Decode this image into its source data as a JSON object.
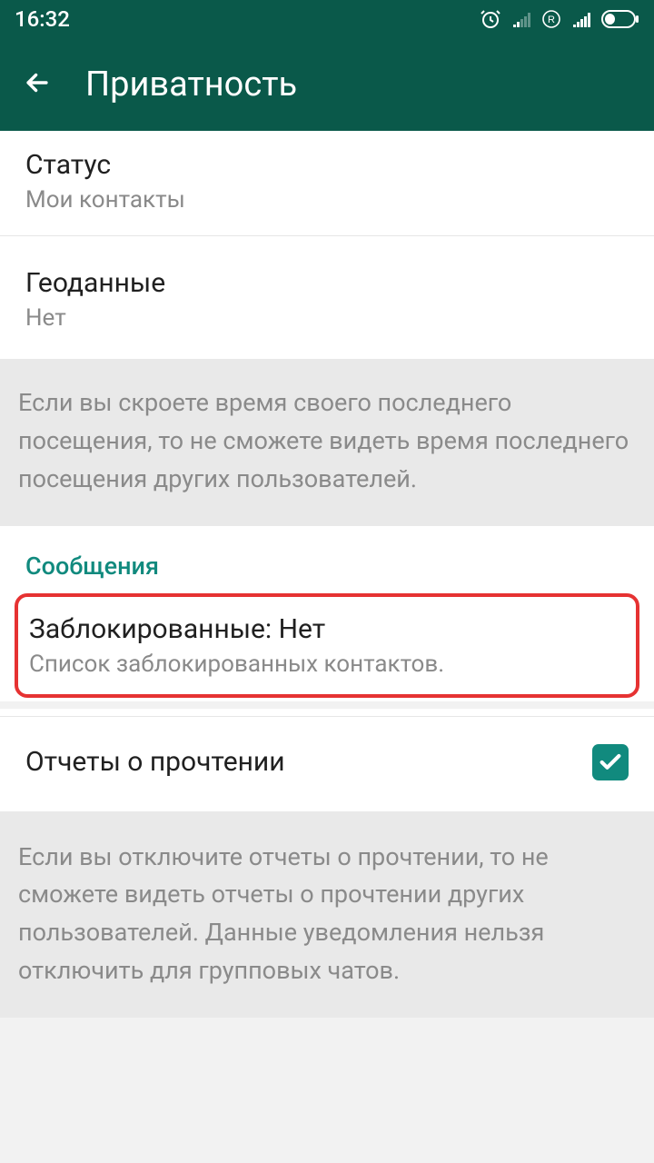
{
  "status": {
    "time": "16:32"
  },
  "header": {
    "title": "Приватность"
  },
  "settings": {
    "status": {
      "title": "Статус",
      "value": "Мои контакты"
    },
    "location": {
      "title": "Геоданные",
      "value": "Нет"
    },
    "last_seen_info": "Если вы скроете время своего последнего посещения, то не сможете видеть время последнего посещения других пользователей.",
    "messages_header": "Сообщения",
    "blocked": {
      "title": "Заблокированные: Нет",
      "sub": "Список заблокированных контактов."
    },
    "read_receipts": {
      "title": "Отчеты о прочтении",
      "checked": true
    },
    "read_receipts_info": "Если вы отключите отчеты о прочтении, то не сможете видеть отчеты о прочтении других пользователей. Данные уведомления нельзя отключить для групповых чатов."
  }
}
